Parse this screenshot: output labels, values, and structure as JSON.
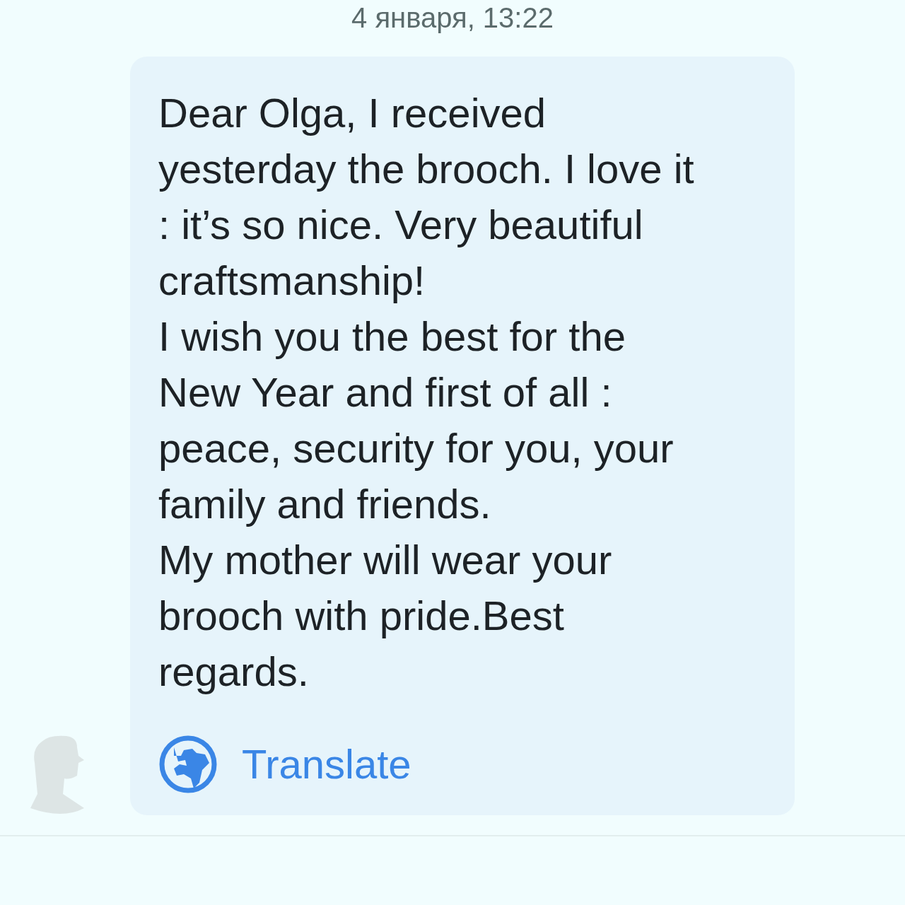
{
  "date_header": "4 января, 13:22",
  "message": {
    "text": "Dear Olga, I received yesterday the brooch. I love it : it’s so nice. Very beautiful craftsmanship!\nI wish you the best for the New Year and first of all : peace, security for you, your family and friends.\nMy mother will wear your brooch with pride.Best regards.",
    "translate_label": "Translate"
  }
}
